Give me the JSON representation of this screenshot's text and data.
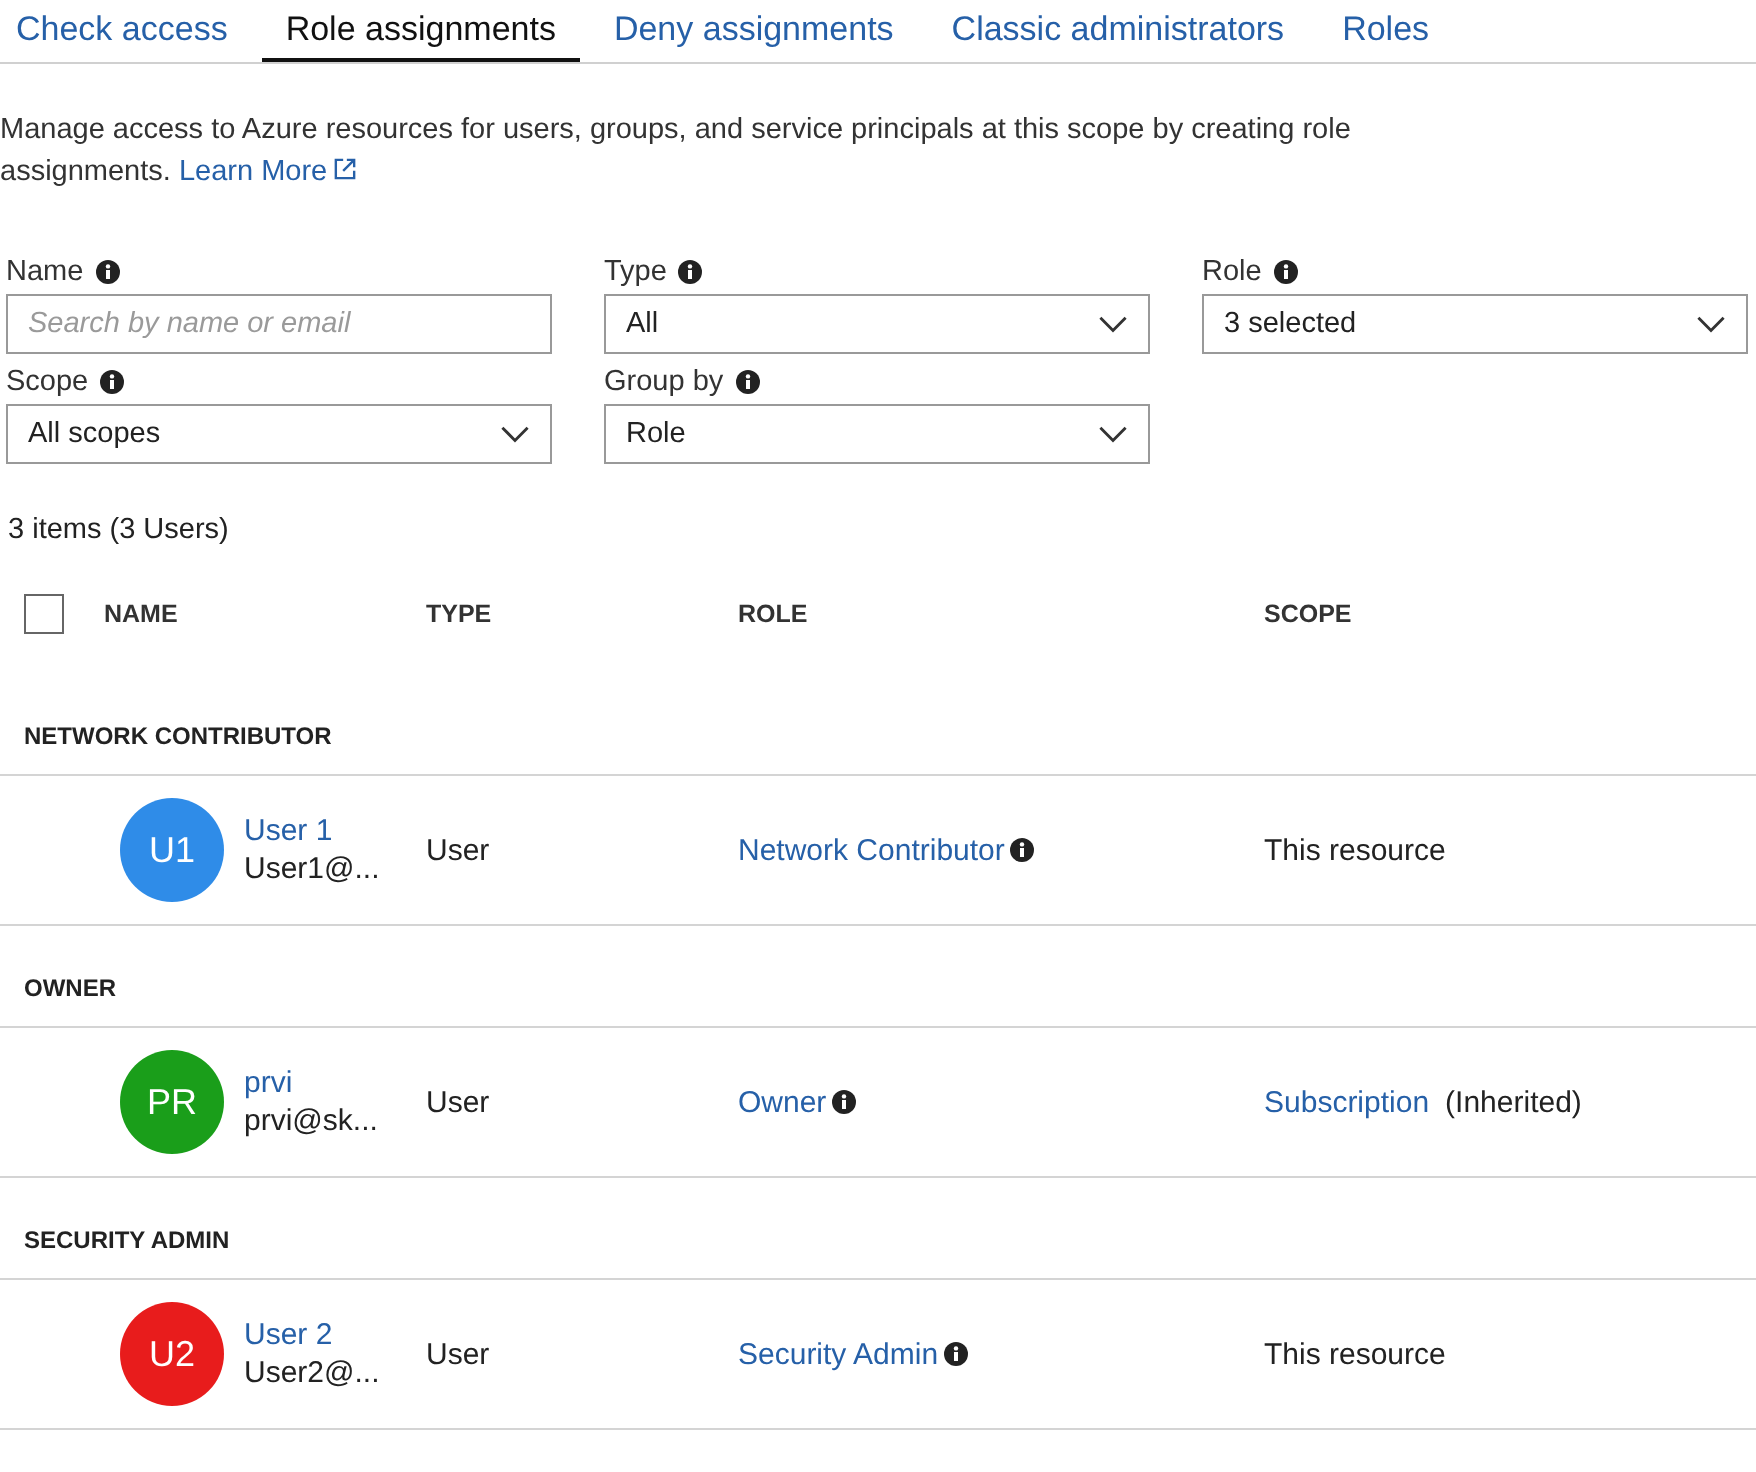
{
  "tabs": [
    {
      "label": "Check access",
      "selected": false
    },
    {
      "label": "Role assignments",
      "selected": true
    },
    {
      "label": "Deny assignments",
      "selected": false
    },
    {
      "label": "Classic administrators",
      "selected": false
    },
    {
      "label": "Roles",
      "selected": false
    }
  ],
  "description": "Manage access to Azure resources for users, groups, and service principals at this scope by creating role assignments.",
  "learn_more": "Learn More",
  "filters": [
    {
      "label": "Name",
      "kind": "search",
      "placeholder": "Search by name or email"
    },
    {
      "label": "Type",
      "kind": "dropdown",
      "value": "All"
    },
    {
      "label": "Role",
      "kind": "dropdown",
      "value": "3 selected"
    },
    {
      "label": "Scope",
      "kind": "dropdown",
      "value": "All scopes"
    },
    {
      "label": "Group by",
      "kind": "dropdown",
      "value": "Role"
    }
  ],
  "summary": "3 items (3 Users)",
  "table": {
    "select_all": {
      "checked": false
    },
    "columns": [
      "NAME",
      "TYPE",
      "ROLE",
      "SCOPE"
    ],
    "groups": [
      {
        "title": "NETWORK CONTRIBUTOR",
        "rows": [
          {
            "initials": "U1",
            "color": "#2f8ce8",
            "name": "User 1",
            "email": "User1@...",
            "type": "User",
            "role": "Network Contributor",
            "scope": {
              "text": "This resource",
              "kind": "plain"
            }
          }
        ]
      },
      {
        "title": "OWNER",
        "rows": [
          {
            "initials": "PR",
            "color": "#1a9e1a",
            "name": "prvi",
            "email": "prvi@sk...",
            "type": "User",
            "role": "Owner",
            "scope": {
              "text": "Subscription",
              "kind": "link",
              "note": "(Inherited)"
            }
          }
        ]
      },
      {
        "title": "SECURITY ADMIN",
        "rows": [
          {
            "initials": "U2",
            "color": "#e81c1c",
            "name": "User 2",
            "email": "User2@...",
            "type": "User",
            "role": "Security Admin",
            "scope": {
              "text": "This resource",
              "kind": "plain"
            }
          }
        ]
      }
    ]
  }
}
